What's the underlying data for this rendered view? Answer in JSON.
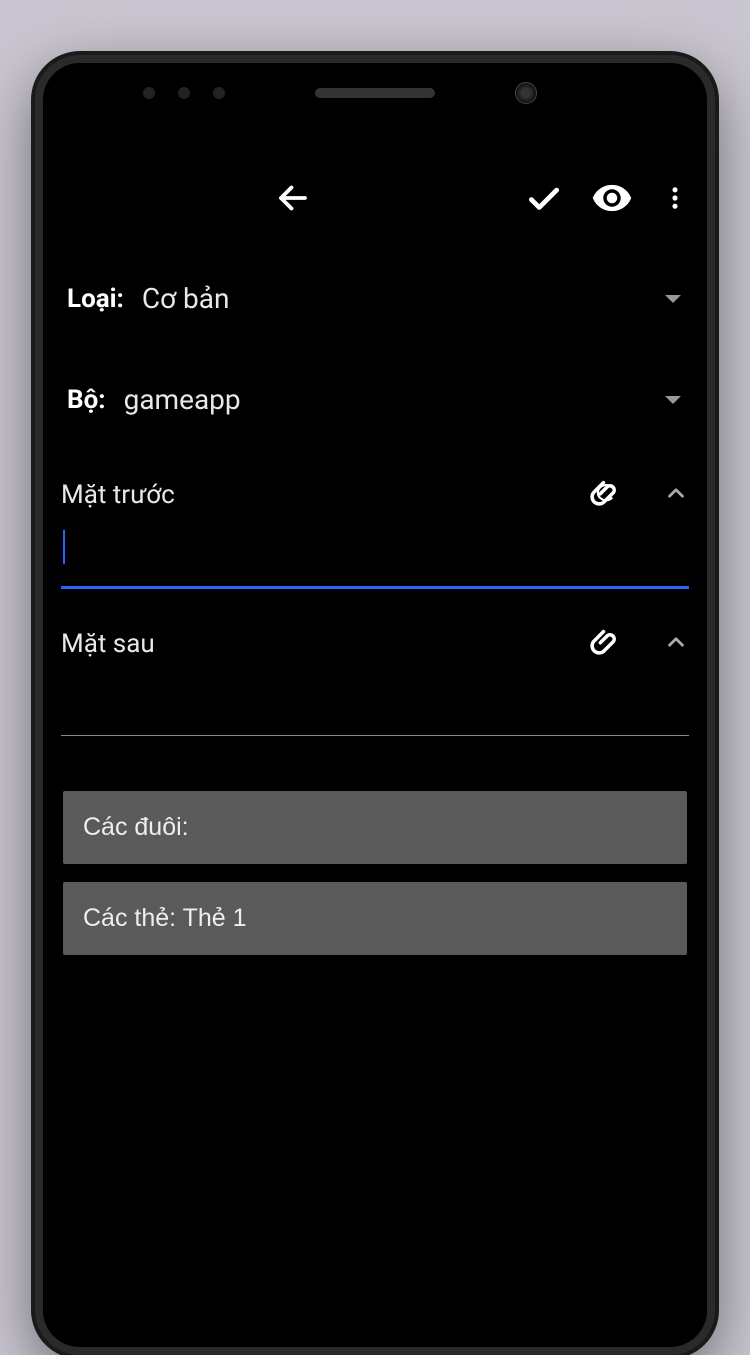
{
  "selectors": {
    "type": {
      "label": "Loại:",
      "value": "Cơ bản"
    },
    "deck": {
      "label": "Bộ:",
      "value": "gameapp"
    }
  },
  "fields": {
    "front": {
      "label": "Mặt trước",
      "value": ""
    },
    "back": {
      "label": "Mặt sau",
      "value": ""
    }
  },
  "footer": {
    "tags": "Các đuôi:",
    "cards": "Các thẻ: Thẻ 1"
  }
}
